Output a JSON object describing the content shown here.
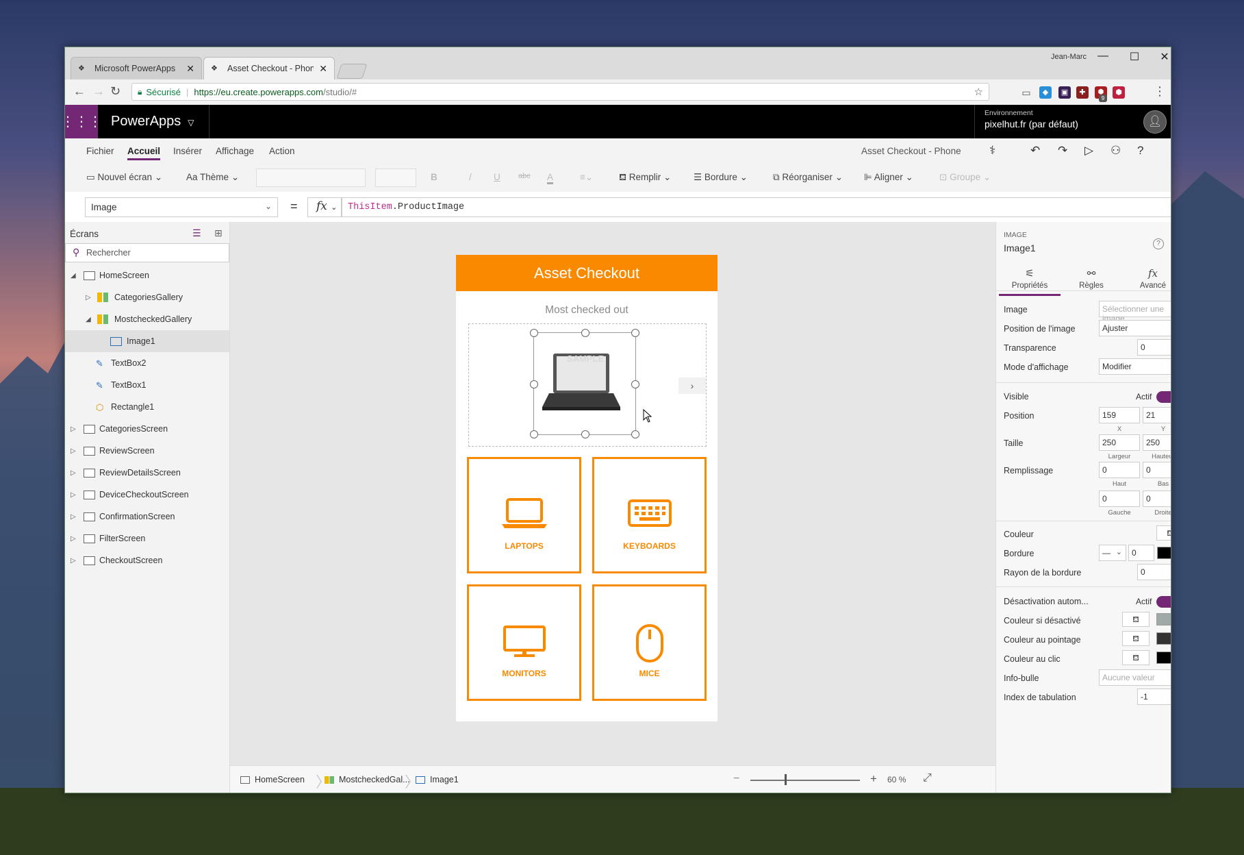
{
  "browser": {
    "tabs": [
      {
        "title": "Microsoft PowerApps"
      },
      {
        "title": "Asset Checkout - Phone"
      }
    ],
    "user": "Jean-Marc",
    "secure_label": "Sécurisé",
    "url_host": "https://eu.create.powerapps.com",
    "url_path": "/studio/#",
    "ext_badge": "9"
  },
  "powerapps": {
    "app_title": "PowerApps",
    "env_label": "Environnement",
    "env_value": "pixelhut.fr (par défaut)"
  },
  "menu": {
    "items": [
      "Fichier",
      "Accueil",
      "Insérer",
      "Affichage",
      "Action"
    ],
    "app_name": "Asset Checkout - Phone"
  },
  "toolbar": {
    "new_screen": "Nouvel écran",
    "theme": "Thème",
    "bold": "B",
    "italic": "/",
    "underline": "U",
    "strike": "abc",
    "font_color": "A",
    "fill": "Remplir",
    "border": "Bordure",
    "reorder": "Réorganiser",
    "align": "Aligner",
    "group": "Groupe"
  },
  "formula_bar": {
    "property": "Image",
    "equals": "=",
    "fx": "fx",
    "formula_keyword": "ThisItem",
    "formula_rest": ".ProductImage"
  },
  "left_panel": {
    "title": "Écrans",
    "search_placeholder": "Rechercher",
    "tree": [
      {
        "label": "HomeScreen"
      },
      {
        "label": "CategoriesGallery"
      },
      {
        "label": "MostcheckedGallery"
      },
      {
        "label": "Image1"
      },
      {
        "label": "TextBox2"
      },
      {
        "label": "TextBox1"
      },
      {
        "label": "Rectangle1"
      },
      {
        "label": "CategoriesScreen"
      },
      {
        "label": "ReviewScreen"
      },
      {
        "label": "ReviewDetailsScreen"
      },
      {
        "label": "DeviceCheckoutScreen"
      },
      {
        "label": "ConfirmationScreen"
      },
      {
        "label": "FilterScreen"
      },
      {
        "label": "CheckoutScreen"
      }
    ]
  },
  "phone": {
    "header": "Asset Checkout",
    "subtitle": "Most checked out",
    "sample_watermark": "SAMPLE",
    "next": "›",
    "tiles": [
      "LAPTOPS",
      "KEYBOARDS",
      "MONITORS",
      "MICE"
    ]
  },
  "status_bar": {
    "crumbs": [
      "HomeScreen",
      "MostcheckedGal...",
      "Image1"
    ],
    "zoom_minus": "−",
    "zoom_plus": "+",
    "zoom_value": "60",
    "zoom_unit": "%"
  },
  "right_panel": {
    "caption": "IMAGE",
    "name": "Image1",
    "tabs": [
      "Propriétés",
      "Règles",
      "Avancé"
    ],
    "image_label": "Image",
    "image_placeholder": "Sélectionner une image",
    "position_image_label": "Position de l'image",
    "position_image_value": "Ajuster",
    "transparency_label": "Transparence",
    "transparency_value": "0",
    "display_mode_label": "Mode d'affichage",
    "display_mode_value": "Modifier",
    "visible_label": "Visible",
    "visible_state": "Actif",
    "position_label": "Position",
    "x": "159",
    "y": "21",
    "x_sub": "X",
    "y_sub": "Y",
    "size_label": "Taille",
    "width": "250",
    "height": "250",
    "width_sub": "Largeur",
    "height_sub": "Hauteur",
    "padding_label": "Remplissage",
    "pad_top": "0",
    "pad_bottom": "0",
    "pad_top_sub": "Haut",
    "pad_bottom_sub": "Bas",
    "pad_left": "0",
    "pad_right": "0",
    "pad_left_sub": "Gauche",
    "pad_right_sub": "Droite",
    "color_label": "Couleur",
    "border_label": "Bordure",
    "border_width": "0",
    "border_color": "#000000",
    "radius_label": "Rayon de la bordure",
    "radius_value": "0",
    "autodisable_label": "Désactivation autom...",
    "autodisable_state": "Actif",
    "disabled_color_label": "Couleur si désactivé",
    "disabled_color": "#a0a8a8",
    "hover_color_label": "Couleur au pointage",
    "hover_color": "#333333",
    "pressed_color_label": "Couleur au clic",
    "pressed_color": "#000000",
    "tooltip_label": "Info-bulle",
    "tooltip_placeholder": "Aucune valeur",
    "tab_index_label": "Index de tabulation",
    "tab_index_value": "-1"
  },
  "colors": {
    "accent": "#742774",
    "orange": "#f98a00"
  }
}
